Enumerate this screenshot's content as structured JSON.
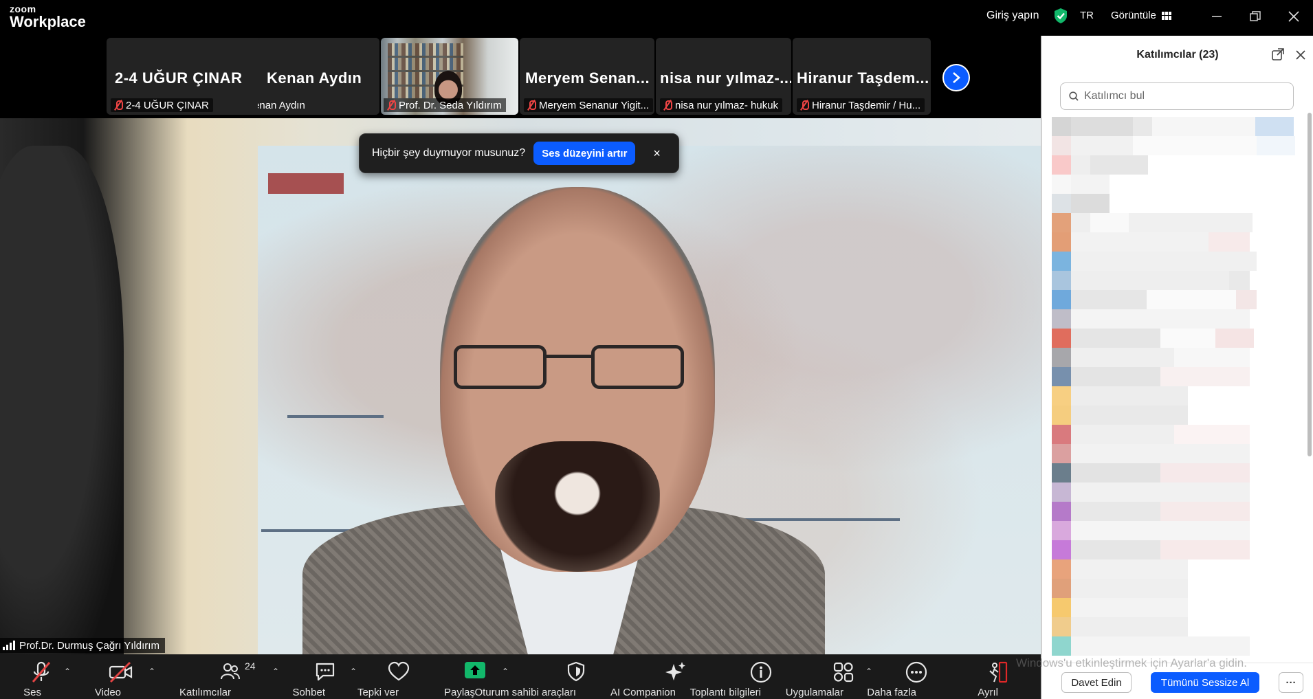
{
  "app": {
    "logo_line1": "zoom",
    "logo_line2": "Workplace"
  },
  "titlebar": {
    "signin": "Giriş yapın",
    "language": "TR",
    "view": "Görüntüle"
  },
  "gallery": {
    "tiles": [
      {
        "big": "2-4 UĞUR ÇINAR",
        "caption": "2-4 UĞUR ÇINAR",
        "muted": true
      },
      {
        "big": "Kenan Aydın",
        "caption": "Kenan Aydın",
        "muted": false
      },
      {
        "big": "",
        "caption": "Prof. Dr. Seda Yıldırım",
        "muted": true
      },
      {
        "big": "Meryem Senan...",
        "caption": "Meryem Senanur Yigit...",
        "muted": true
      },
      {
        "big": "nisa nur yılmaz-...",
        "caption": "nisa nur yılmaz- hukuk",
        "muted": true
      },
      {
        "big": "Hiranur Taşdem...",
        "caption": "Hiranur Taşdemir / Hu...",
        "muted": true
      }
    ]
  },
  "notification": {
    "message": "Hiçbir şey duymuyor musunuz?",
    "action": "Ses düzeyini artır",
    "close": "×"
  },
  "main_video": {
    "speaker": "Prof.Dr. Durmuş Çağrı Yıldırım",
    "watermark": "Windows'u etkinleştirmek için Ayarlar'a gidin."
  },
  "toolbar": {
    "audio": "Ses",
    "video": "Video",
    "participants": "Katılımcılar",
    "participants_count": "24",
    "chat": "Sohbet",
    "react": "Tepki ver",
    "share": "Paylaş",
    "host_tools": "Oturum sahibi araçları",
    "ai": "AI Companion",
    "info": "Toplantı bilgileri",
    "apps": "Uygulamalar",
    "more": "Daha fazla",
    "leave": "Ayrıl"
  },
  "panel": {
    "title": "Katılımcılar (23)",
    "search_placeholder": "Katılımcı bul",
    "invite": "Davet Edin",
    "mute_all": "Tümünü Sessize Al",
    "more": "···"
  },
  "colors": {
    "accent": "#0b5cff",
    "mute_red": "#e44444",
    "share_green": "#12b76a",
    "leave_red": "#e02828"
  }
}
